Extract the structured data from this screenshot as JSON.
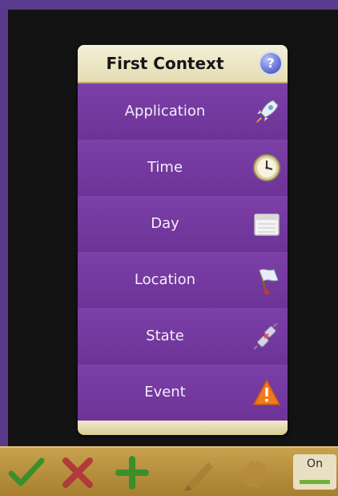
{
  "dialog": {
    "title": "First Context",
    "items": [
      {
        "label": "Application",
        "icon": "rocket-icon"
      },
      {
        "label": "Time",
        "icon": "clock-icon"
      },
      {
        "label": "Day",
        "icon": "calendar-icon"
      },
      {
        "label": "Location",
        "icon": "flag-icon"
      },
      {
        "label": "State",
        "icon": "plug-icon"
      },
      {
        "label": "Event",
        "icon": "warning-icon"
      }
    ]
  },
  "bottom_bar": {
    "toggle_label": "On"
  },
  "colors": {
    "dialog_purple": "#7a3aa4",
    "header_cream": "#efe9c8",
    "bar_gold": "#b88f3c"
  }
}
